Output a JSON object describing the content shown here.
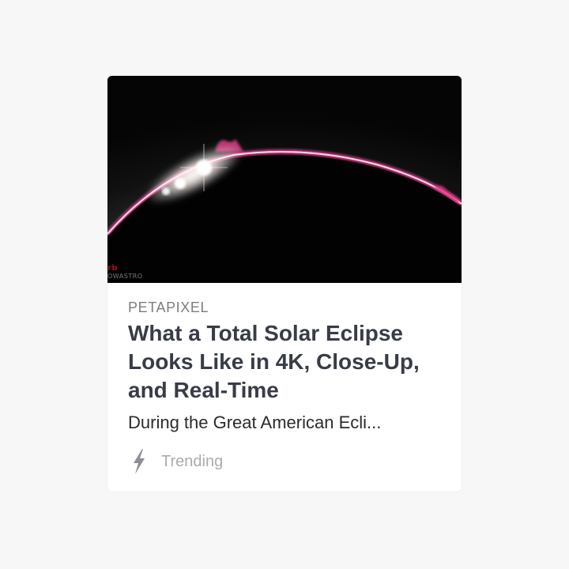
{
  "card": {
    "image_alt": "Total solar eclipse with pink solar prominences over black lunar disc",
    "image_watermark": "OWASTRO",
    "image_watermark_mark": "rb",
    "source": "PETAPIXEL",
    "title": "What a Total Solar Eclipse Looks Like in 4K, Close-Up, and Real-Time",
    "description": "During the Great American Ecli...",
    "tag_icon": "lightning-bolt-icon",
    "tag_label": "Trending"
  },
  "colors": {
    "page_background": "#f7f7f7",
    "card_background": "#ffffff",
    "source_text": "#7b7d82",
    "title_text": "#383c47",
    "description_text": "#2b2b2e",
    "tag_text": "#a9abaf",
    "prominence_pink": "#e0408f"
  }
}
